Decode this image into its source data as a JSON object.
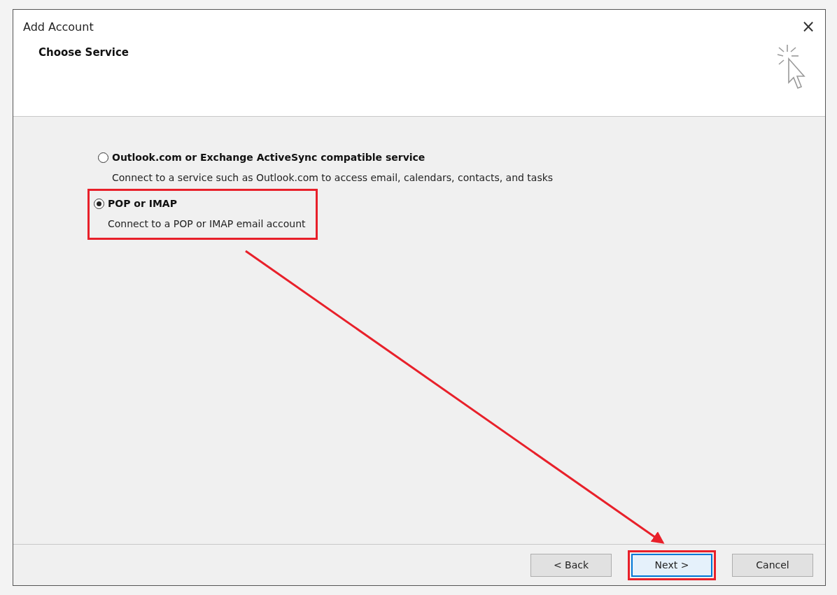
{
  "window": {
    "title": "Add Account",
    "close": "×"
  },
  "header": {
    "title": "Choose Service"
  },
  "options": [
    {
      "label": "Outlook.com or Exchange ActiveSync compatible service",
      "description": "Connect to a service such as Outlook.com to access email, calendars, contacts, and tasks",
      "selected": false,
      "highlighted": false
    },
    {
      "label": "POP or IMAP",
      "description": "Connect to a POP or IMAP email account",
      "selected": true,
      "highlighted": true
    }
  ],
  "buttons": [
    {
      "label": "< Back",
      "default": false,
      "highlighted": false
    },
    {
      "label": "Next >",
      "default": true,
      "highlighted": true
    },
    {
      "label": "Cancel",
      "default": false,
      "highlighted": false
    }
  ],
  "annotation": {
    "arrow": true
  }
}
